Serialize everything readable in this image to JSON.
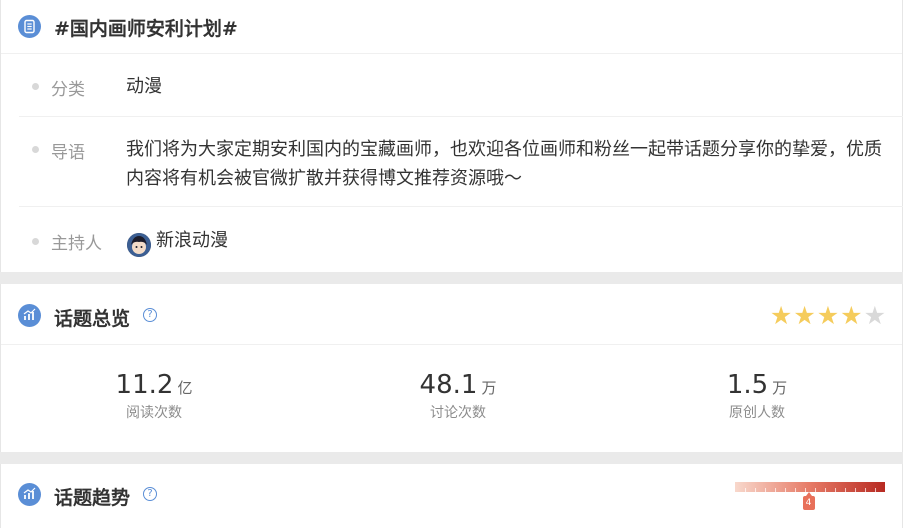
{
  "topic": {
    "title": "#国内画师安利计划#",
    "rows": [
      {
        "label": "分类",
        "value": "动漫"
      },
      {
        "label": "导语",
        "value": "我们将为大家定期安利国内的宝藏画师，也欢迎各位画师和粉丝一起带话题分享你的挚爱，优质内容将有机会被官微扩散并获得博文推荐资源哦～"
      },
      {
        "label": "主持人",
        "value": "新浪动漫"
      }
    ]
  },
  "overview": {
    "title": "话题总览",
    "help": "?",
    "rating": {
      "score": 4,
      "max": 5
    },
    "stats": [
      {
        "value": "11.2",
        "unit": "亿",
        "label": "阅读次数"
      },
      {
        "value": "48.1",
        "unit": "万",
        "label": "讨论次数"
      },
      {
        "value": "1.5",
        "unit": "万",
        "label": "原创人数"
      }
    ]
  },
  "trend": {
    "title": "话题趋势",
    "help": "?",
    "level": "4",
    "level_fraction": 0.49
  },
  "colors": {
    "accent": "#5a8ed6",
    "star": "#f5cc5c",
    "heat": "#b72a22"
  }
}
